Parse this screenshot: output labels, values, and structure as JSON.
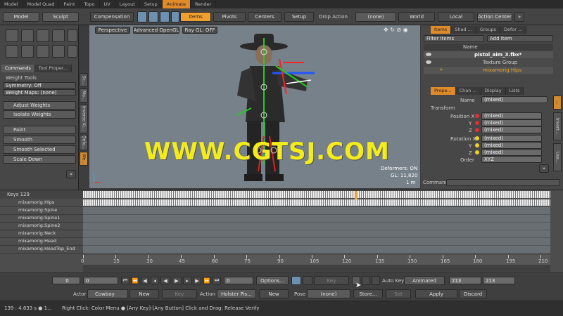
{
  "menu_tabs": [
    "Model",
    "Model Quad",
    "Paint",
    "Topo",
    "UV",
    "Layout",
    "Setup",
    "Animate",
    "Render"
  ],
  "toolbar": {
    "model": "Model",
    "sculpt": "Sculpt",
    "compensation": "Compensation",
    "items": "Items",
    "pivots": "Pivots",
    "centers": "Centers",
    "setup": "Setup",
    "drop_action": "Drop Action",
    "drop_value": "(none)",
    "world": "World",
    "local": "Local",
    "action_center": "Action Center"
  },
  "left": {
    "tab_commands": "Commands",
    "tab_tool": "Tool Proper...",
    "weight_tools": "Weight Tools",
    "symmetry": "Symmetry: Off",
    "weight_maps": "Weight Maps: (none)",
    "adjust_weights": "Adjust Weights",
    "isolate_weights": "Isolate Weights",
    "paint": "Paint",
    "smooth": "Smooth",
    "smooth_selected": "Smooth Selected",
    "scale_down": "Scale Down",
    "vtabs": [
      "Sc...",
      "Mo...",
      "Inverse Ki...",
      "Defo...",
      "We..."
    ]
  },
  "viewport": {
    "perspective": "Perspective",
    "advanced": "Advanced OpenGL",
    "raygl": "Ray GL: OFF",
    "deformers": "Deformers: ON",
    "gl": "GL: 11,820",
    "scale": "1 m"
  },
  "watermark": "WWW.CGTSJ.COM",
  "right": {
    "tabs_top": [
      "Items",
      "Shad ...",
      "Groups",
      "Defor ..."
    ],
    "filter_items": "Filter Items",
    "add_item": "Add Item",
    "name_col": "Name",
    "tree": [
      "pistol_aim_3.fbx*",
      "Texture Group",
      "mixamorig:Hips"
    ],
    "tabs_mid": [
      "Prope...",
      "Chan ...",
      "Display",
      "Lists"
    ],
    "name_label": "Name",
    "name_value": "(mixed)",
    "transform": "Transform",
    "position_x": "Position X",
    "rotation_x": "Rotation X",
    "y": "Y",
    "z": "Z",
    "mixed": "(mixed)",
    "order": "Order",
    "order_value": "XYZ",
    "side_tabs": [
      "...",
      "Invert...",
      "Use..."
    ],
    "command": "Command"
  },
  "dopesheet": {
    "keys": "Keys 129",
    "tracks": [
      "mixamorig:Hips",
      "mixamorig:Spine",
      "mixamorig:Spine1",
      "mixamorig:Spine2",
      "mixamorig:Neck",
      "mixamorig:Head",
      "mixamorig:HeadTop_End"
    ],
    "ruler": [
      "0",
      "15",
      "30",
      "45",
      "60",
      "75",
      "90",
      "105",
      "120",
      "135",
      "150",
      "165",
      "180",
      "195",
      "210"
    ]
  },
  "transport": {
    "start": "0",
    "current": "0",
    "field3": "0",
    "options": "Options...",
    "key": "Key",
    "auto_key": "Auto Key",
    "animated": "Animated",
    "end1": "213",
    "end2": "213"
  },
  "actorbar": {
    "actor": "Actor",
    "actor_value": "Cowboy",
    "new1": "New",
    "key": "Key",
    "action": "Action",
    "action_value": "Holster Pis...",
    "new2": "New",
    "pose": "Pose",
    "pose_value": "(none)",
    "store": "Store...",
    "set": "Set",
    "apply": "Apply",
    "discard": "Discard"
  },
  "status": {
    "left": "139 : 4.633 s ● 1...",
    "hint": "Right Click: Color Menu ● [Any Key]-[Any Button] Click and Drag: Release Verify"
  },
  "colors": {
    "accent": "#f0a030",
    "viewport": "#77818a",
    "watermark": "#f4ec1a",
    "red": "#e03030",
    "yellow": "#f0d020"
  }
}
